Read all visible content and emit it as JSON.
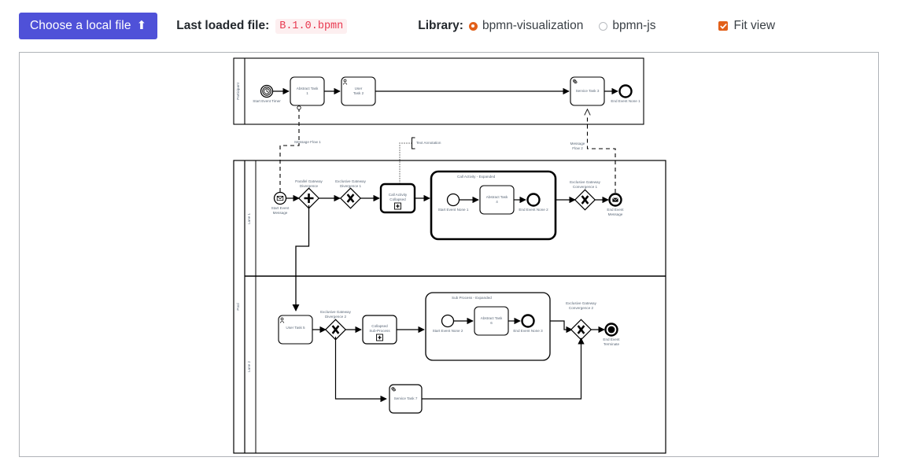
{
  "toolbar": {
    "choose_file_label": "Choose a local file",
    "choose_file_icon": "upload-icon",
    "last_loaded_label": "Last loaded file:",
    "last_loaded_value": "B.1.0.bpmn",
    "library_label": "Library:",
    "library_options": [
      {
        "label": "bpmn-visualization",
        "selected": true
      },
      {
        "label": "bpmn-js",
        "selected": false
      }
    ],
    "fit_view_label": "Fit view",
    "fit_view_checked": true,
    "accent_color": "#e2601a",
    "button_color": "#4f51d8",
    "code_color": "#e8384f"
  },
  "diagram": {
    "type": "bpmn",
    "pools": [
      {
        "name": "participant-pool",
        "label": "Participant"
      },
      {
        "name": "main-pool",
        "label": "Pool",
        "lanes": [
          "Lane 1",
          "Lane 2"
        ]
      }
    ],
    "elements": {
      "start_event_timer": "Start Event Timer",
      "abstract_task_1": "Abstract Task 1",
      "user_task_2": "User Task 2",
      "service_task_3": "Service Task 3",
      "end_event_none_1": "End Event None 1",
      "start_event_message": "Start Event Message",
      "parallel_gateway_divergence": "Parallel Gateway Divergence",
      "exclusive_gateway_divergence_1": "Exclusive Gateway Divergence 1",
      "call_activity_collapsed": "Call Activity Collapsed",
      "call_activity_expanded": "Call Activity - Expanded",
      "start_event_none_1": "Start Event None 1",
      "abstract_task_4": "Abstract Task 4",
      "end_event_none_2": "End Event None 2",
      "exclusive_gateway_convergence_1": "Exclusive Gateway Convergence 1",
      "end_event_message": "End Event Message",
      "user_task_5": "User Task 5",
      "exclusive_gateway_divergence_2": "Exclusive Gateway Divergence 2",
      "collapsed_sub_process": "Collapsed Sub-Process",
      "sub_process_expanded": "Sub Process - Expanded",
      "start_event_none_2": "Start Event None 2",
      "abstract_task_6": "Abstract Task 6",
      "end_event_none_3": "End Event None 3",
      "exclusive_gateway_convergence_2": "Exclusive Gateway Convergence 2",
      "end_event_terminate": "End Event Terminate",
      "service_task_7": "Service Task 7",
      "message_flow_1": "Message Flow 1",
      "message_flow_2_line1": "Message",
      "message_flow_2_line2": "Flow 2",
      "text_annotation": "Text Annotation"
    },
    "label_color": "#5b6878",
    "stroke_color": "#000000"
  }
}
